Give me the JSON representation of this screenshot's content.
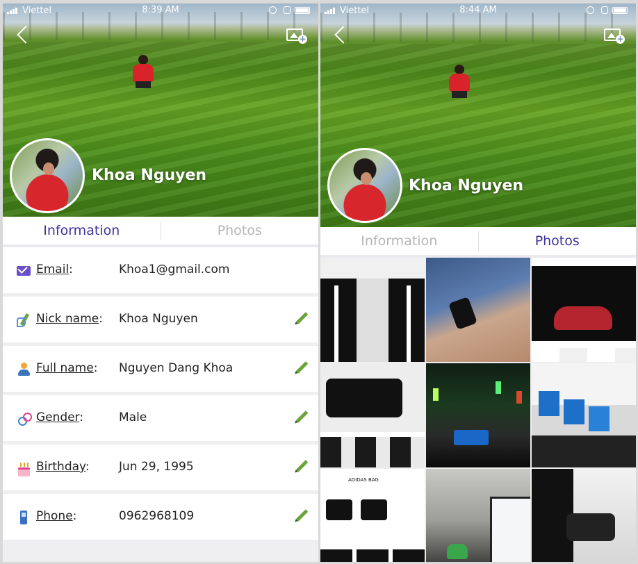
{
  "left_screen": {
    "status": {
      "carrier": "Viettel",
      "time": "8:39 AM"
    },
    "profile_name": "Khoa Nguyen",
    "tabs": [
      {
        "label": "Information",
        "active": true
      },
      {
        "label": "Photos",
        "active": false
      }
    ],
    "fields": [
      {
        "label": "Email",
        "value": "Khoa1@gmail.com",
        "icon": "email-icon",
        "editable": false
      },
      {
        "label": "Nick name",
        "value": "Khoa Nguyen",
        "icon": "nickname-icon",
        "editable": true
      },
      {
        "label": "Full name",
        "value": "Nguyen Dang Khoa",
        "icon": "user-icon",
        "editable": true
      },
      {
        "label": "Gender",
        "value": "Male",
        "icon": "gender-icon",
        "editable": true
      },
      {
        "label": "Birthday",
        "value": "Jun 29, 1995",
        "icon": "birthday-cake-icon",
        "editable": true
      },
      {
        "label": "Phone",
        "value": "0962968109",
        "icon": "phone-icon",
        "editable": true
      }
    ]
  },
  "right_screen": {
    "status": {
      "carrier": "Viettel",
      "time": "8:44 AM"
    },
    "profile_name": "Khoa Nguyen",
    "tabs": [
      {
        "label": "Information",
        "active": false
      },
      {
        "label": "Photos",
        "active": true
      }
    ],
    "photo_captions": {
      "adidas_bag": "ADIDAS BAG"
    }
  },
  "colors": {
    "active_tab": "#3d34a0",
    "inactive_tab": "#b5b5b8",
    "edit_icon": "#6aa43a"
  }
}
